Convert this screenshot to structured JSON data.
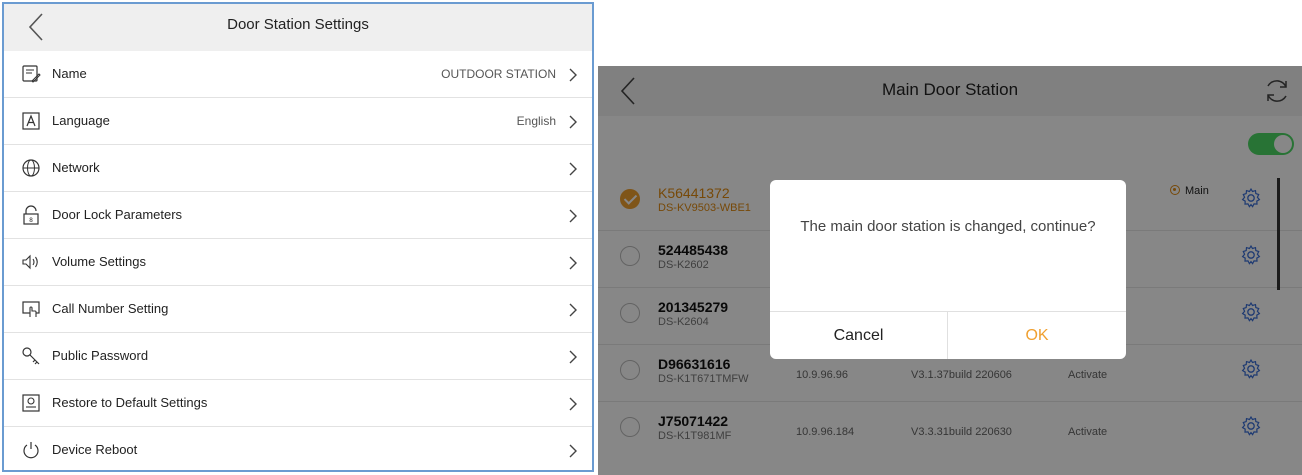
{
  "left_panel": {
    "title": "Door Station Settings",
    "items": [
      {
        "label": "Name",
        "value": "OUTDOOR STATION",
        "icon": "name-card-icon"
      },
      {
        "label": "Language",
        "value": "English",
        "icon": "language-icon"
      },
      {
        "label": "Network",
        "value": "",
        "icon": "globe-icon"
      },
      {
        "label": "Door Lock Parameters",
        "value": "",
        "icon": "lock-icon"
      },
      {
        "label": "Volume Settings",
        "value": "",
        "icon": "speaker-icon"
      },
      {
        "label": "Call Number Setting",
        "value": "",
        "icon": "call-touch-icon"
      },
      {
        "label": "Public Password",
        "value": "",
        "icon": "key-icon"
      },
      {
        "label": "Restore to Default Settings",
        "value": "",
        "icon": "restore-icon"
      },
      {
        "label": "Device Reboot",
        "value": "",
        "icon": "power-icon"
      }
    ]
  },
  "right_panel": {
    "title": "Main Door Station",
    "toggle_on": true,
    "devices": [
      {
        "serial": "K56441372",
        "model": "DS-KV9503-WBE1",
        "ip": "",
        "version": "",
        "status": "",
        "main_label": "Main",
        "selected": true
      },
      {
        "serial": "524485438",
        "model": "DS-K2602",
        "ip": "",
        "version": "",
        "status": "",
        "main_label": "",
        "selected": false
      },
      {
        "serial": "201345279",
        "model": "DS-K2604",
        "ip": "",
        "version": "",
        "status": "",
        "main_label": "",
        "selected": false
      },
      {
        "serial": "D96631616",
        "model": "DS-K1T671TMFW",
        "ip": "10.9.96.96",
        "version": "V3.1.37build 220606",
        "status": "Activate",
        "main_label": "",
        "selected": false
      },
      {
        "serial": "J75071422",
        "model": "DS-K1T981MF",
        "ip": "10.9.96.184",
        "version": "V3.3.31build 220630",
        "status": "Activate",
        "main_label": "",
        "selected": false
      }
    ],
    "dialog": {
      "message": "The main door station is changed, continue?",
      "cancel_label": "Cancel",
      "ok_label": "OK"
    }
  },
  "colors": {
    "accent": "#f0a030",
    "toggle": "#4cd964",
    "gear": "#3a6fd8",
    "frame_border": "#6a9bd1"
  }
}
